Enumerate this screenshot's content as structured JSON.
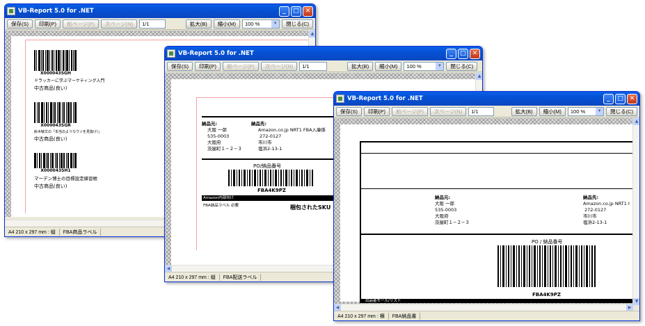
{
  "windows": [
    {
      "title": "VB-Report 5.0 for .NET",
      "toolbar": {
        "save": "保存(S)",
        "print": "印刷(P)",
        "prev": "前ページ(P)",
        "next": "次ページ(N)",
        "page": "1/1",
        "zoom_in": "拡大(B)",
        "zoom_out": "縮小(M)",
        "zoom": "100 %",
        "close": "閉じる(C)"
      },
      "status": {
        "paper": "A4 210 x 297 mm : 縦",
        "report": "FBA商品ラベル"
      },
      "labels": [
        {
          "code": "X000043SGH",
          "title": "ドラッカーに学ぶマーケティング入門",
          "condition": "中古商品(良い)"
        },
        {
          "code": "X000043SGR",
          "title": "鈴木敏文の「本当のようなウソを見抜け!」",
          "condition": "中古商品(良い)"
        },
        {
          "code": "X000043SH1",
          "title": "マーデン博士の目標設定練習帳",
          "condition": "中古商品(良い)"
        }
      ]
    },
    {
      "title": "VB-Report 5.0 for .NET",
      "toolbar": {
        "save": "保存(S)",
        "print": "印刷(P)",
        "prev": "前ページ(P)",
        "next": "次ページ(N)",
        "page": "1/1",
        "zoom_in": "拡大(B)",
        "zoom_out": "縮小(M)",
        "zoom": "100 %",
        "close": "閉じる(C)"
      },
      "status": {
        "paper": "A4 210 x 297 mm : 縦",
        "report": "FBA配送ラベル"
      },
      "from": {
        "heading": "納品元:",
        "lines": [
          "大阪 一郎",
          "535-0003",
          "大阪府",
          "茨屋町１−２−３"
        ]
      },
      "to": {
        "heading": "納品先:",
        "lines": [
          "Amazon.co.jp NRT1 FBA入庫係",
          "272-0127",
          "市川市",
          "塩浜2-13-1"
        ]
      },
      "po_label": "PO/納品番号",
      "po_code": "FBA4K9PZ",
      "amazon_note": "Amazon内部向け",
      "label_note": "FBA納品ラベル 必要",
      "sku": "梱包されたSKU"
    },
    {
      "title": "VB-Report 5.0 for .NET",
      "toolbar": {
        "save": "保存(S)",
        "print": "印刷(P)",
        "prev": "前ページ(P)",
        "next": "次ページ(N)",
        "page": "1/1",
        "zoom_in": "拡大(B)",
        "zoom_out": "縮小(M)",
        "zoom": "100 %",
        "close": "閉じる(C)"
      },
      "status": {
        "paper": "A4 210 x 297 mm : 横",
        "report": "FBA納品書"
      },
      "from": {
        "heading": "納品元:",
        "lines": [
          "大阪 一郎",
          "535-0003",
          "大阪府",
          "茨屋町１−２−３"
        ]
      },
      "to": {
        "heading": "納品先:",
        "lines": [
          "Amazon.co.jp NRT1 I",
          "272-0127",
          "市川市",
          "塩浜2-13-1"
        ]
      },
      "po_label": "PO / 納品番号",
      "po_code": "FBA4K9PZ",
      "bottom_band": "出品者モール/リスト"
    }
  ]
}
